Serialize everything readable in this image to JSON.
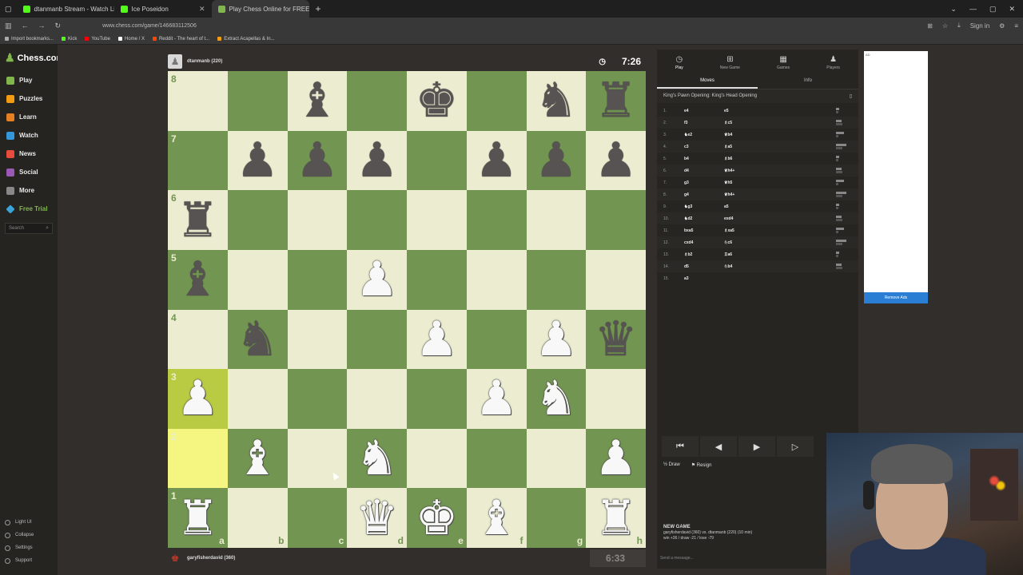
{
  "browser": {
    "tabs": [
      {
        "label": "dtanmanb Stream - Watch Live",
        "color": "#53fc18",
        "active": false
      },
      {
        "label": "Ice Poseidon",
        "color": "#53fc18",
        "active": false
      },
      {
        "label": "Play Chess Online for FREE",
        "color": "#81b64c",
        "active": true
      }
    ],
    "new_tab": "+",
    "url": "www.chess.com/game/146683112506",
    "bookmarks": [
      "Import bookmarks...",
      "Kick",
      "YouTube",
      "Home / X",
      "Reddit - The heart of t...",
      "Extract Acapellas & In..."
    ],
    "sign_in": "Sign in"
  },
  "nav": {
    "logo": "Chess.com",
    "items": [
      {
        "label": "Play",
        "color": "#81b64c"
      },
      {
        "label": "Puzzles",
        "color": "#f39c12"
      },
      {
        "label": "Learn",
        "color": "#e67e22"
      },
      {
        "label": "Watch",
        "color": "#3498db"
      },
      {
        "label": "News",
        "color": "#e74c3c"
      },
      {
        "label": "Social",
        "color": "#9b59b6"
      },
      {
        "label": "More",
        "color": "#888888"
      }
    ],
    "free_trial": "Free Trial",
    "search_placeholder": "Search",
    "bottom": [
      "Light UI",
      "Collapse",
      "Settings",
      "Support"
    ]
  },
  "top_player": {
    "name": "dtanmanb (220)",
    "clock": "7:26"
  },
  "bottom_player": {
    "name": "garyfisherdavid (360)",
    "clock": "6:33"
  },
  "board": {
    "ranks": [
      "8",
      "7",
      "6",
      "5",
      "4",
      "3",
      "2",
      "1"
    ],
    "files": [
      "a",
      "b",
      "c",
      "d",
      "e",
      "f",
      "g",
      "h"
    ],
    "position": [
      [
        "",
        "",
        "bB",
        "",
        "bK",
        "",
        "bN",
        "bR"
      ],
      [
        "",
        "bP",
        "bP",
        "bP",
        "",
        "bP",
        "bP",
        "bP"
      ],
      [
        "bR",
        "",
        "",
        "",
        "",
        "",
        "",
        ""
      ],
      [
        "bB",
        "",
        "",
        "wP",
        "",
        "",
        "",
        ""
      ],
      [
        "",
        "bN",
        "",
        "",
        "wP",
        "",
        "wP",
        "bQ"
      ],
      [
        "wP",
        "",
        "",
        "",
        "",
        "wP",
        "wN",
        ""
      ],
      [
        "",
        "wB",
        "",
        "wN",
        "",
        "",
        "",
        "wP"
      ],
      [
        "wR",
        "",
        "",
        "wQ",
        "wK",
        "wB",
        "",
        "wR"
      ]
    ],
    "highlight": [
      "a3",
      "a2"
    ]
  },
  "panel": {
    "tabs": [
      "Play",
      "New Game",
      "Games",
      "Players"
    ],
    "subtabs": [
      "Moves",
      "Info"
    ],
    "opening": "King's Pawn Opening: King's Head Opening",
    "moves": [
      {
        "n": "1.",
        "w": "e4",
        "b": "e5"
      },
      {
        "n": "2.",
        "w": "f3",
        "b": "♗c5"
      },
      {
        "n": "3.",
        "w": "♞e2",
        "b": "♕b4"
      },
      {
        "n": "4.",
        "w": "c3",
        "b": "♗a5"
      },
      {
        "n": "5.",
        "w": "b4",
        "b": "♗b6"
      },
      {
        "n": "6.",
        "w": "d4",
        "b": "♕h4+"
      },
      {
        "n": "7.",
        "w": "g3",
        "b": "♕h5"
      },
      {
        "n": "8.",
        "w": "g4",
        "b": "♕h4+"
      },
      {
        "n": "9.",
        "w": "♞g3",
        "b": "a5"
      },
      {
        "n": "10.",
        "w": "♞d2",
        "b": "exd4"
      },
      {
        "n": "11.",
        "w": "bxa5",
        "b": "♗xa5"
      },
      {
        "n": "12.",
        "w": "cxd4",
        "b": "♘c6"
      },
      {
        "n": "13.",
        "w": "♗b2",
        "b": "♖a6"
      },
      {
        "n": "14.",
        "w": "d5",
        "b": "♘b4"
      },
      {
        "n": "15.",
        "w": "a3",
        "b": ""
      }
    ],
    "draw": "Draw",
    "resign": "Resign",
    "new_game_title": "NEW GAME",
    "new_game_line1": "garyfisherdavid (360) vs. dtanmanb (220) (10 min)",
    "new_game_line2": "win +36 / draw -21 / lose -79",
    "message_placeholder": "Send a message..."
  },
  "ad": {
    "tag": "AD",
    "remove": "Remove Ads"
  },
  "colors": {
    "light_square": "#ebecd0",
    "dark_square": "#739552",
    "highlight_light": "#f5f682",
    "highlight_dark": "#b9ca43",
    "accent": "#81b64c"
  }
}
